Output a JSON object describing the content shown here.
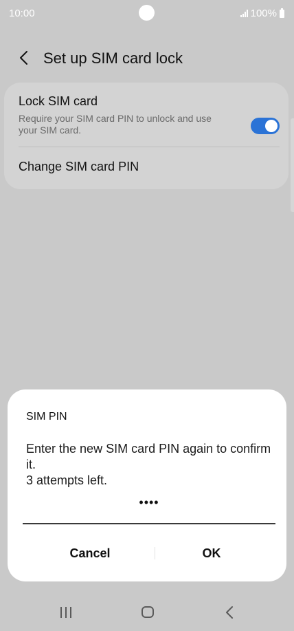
{
  "status_bar": {
    "time": "10:00",
    "battery": "100%",
    "icons": [
      "signal-icon",
      "battery-icon"
    ]
  },
  "header": {
    "title": "Set up SIM card lock",
    "back_icon": "chevron-left-icon"
  },
  "settings": {
    "lock_sim": {
      "title": "Lock SIM card",
      "description": "Require your SIM card PIN to unlock and use your SIM card.",
      "enabled": true
    },
    "change_pin": {
      "title": "Change SIM card PIN"
    }
  },
  "dialog": {
    "title": "SIM PIN",
    "message_line1": "Enter the new SIM card PIN again to confirm it.",
    "message_line2": "3 attempts left.",
    "pin_value": "••••",
    "cancel_label": "Cancel",
    "ok_label": "OK"
  },
  "nav_bar": {
    "icons": [
      "recent-apps-icon",
      "home-icon",
      "back-icon"
    ]
  },
  "colors": {
    "accent": "#2b73d6",
    "dim_background": "#c9c9c9",
    "dialog_background": "#ffffff"
  }
}
